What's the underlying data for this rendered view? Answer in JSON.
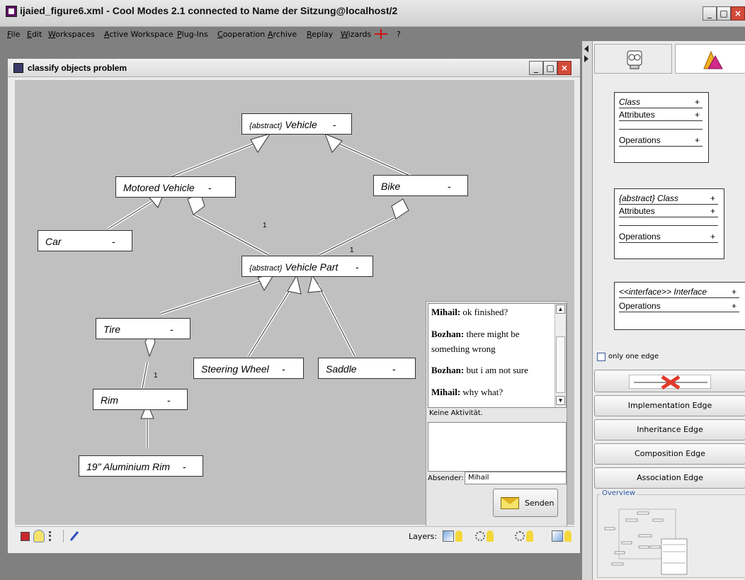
{
  "window": {
    "title": "ijaied_figure6.xml - Cool Modes 2.1 connected to Name der Sitzung@localhost/2"
  },
  "menu": {
    "items": [
      "File",
      "Edit",
      "Workspaces",
      "Active Workspace",
      "Plug-Ins",
      "Cooperation",
      "Archive",
      "Replay",
      "Wizards",
      "?"
    ]
  },
  "inner_window": {
    "title": "classify objects problem"
  },
  "diagram": {
    "nodes": [
      {
        "label_tag": "{abstract}",
        "label": "Vehicle",
        "dash": "-"
      },
      {
        "label": "Motored Vehicle",
        "dash": "-"
      },
      {
        "label": "Bike",
        "dash": "-"
      },
      {
        "label": "Car",
        "dash": "-"
      },
      {
        "label_tag": "{abstract}",
        "label": "Vehicle Part",
        "dash": "-"
      },
      {
        "label": "Tire",
        "dash": "-"
      },
      {
        "label": "Steering Wheel",
        "dash": "-"
      },
      {
        "label": "Saddle",
        "dash": "-"
      },
      {
        "label": "Rim",
        "dash": "-"
      },
      {
        "label": "19\" Aluminium Rim",
        "dash": "-"
      }
    ],
    "multiplicities": [
      "1",
      "1",
      "1"
    ]
  },
  "chat": {
    "messages": [
      {
        "sender": "Mihail:",
        "text": "ok finished?"
      },
      {
        "sender": "Bozhan:",
        "text": "there might be something wrong"
      },
      {
        "sender": "Bozhan:",
        "text": "but i am not sure"
      },
      {
        "sender": "Mihail:",
        "text": "why what?"
      }
    ],
    "status": "Keine Aktivität.",
    "sender_label": "Absender:",
    "sender_value": "Mihail",
    "send_label": "Senden"
  },
  "bottom": {
    "layers_label": "Layers:"
  },
  "palette": {
    "class_box": {
      "name": "Class",
      "attributes": "Attributes",
      "operations": "Operations",
      "plus": "+"
    },
    "abstract_box": {
      "name": "{abstract} Class",
      "attributes": "Attributes",
      "operations": "Operations",
      "plus": "+"
    },
    "interface_box": {
      "name": "<<interface>> Interface",
      "operations": "Operations",
      "plus": "+"
    },
    "only_one_edge": "only one edge",
    "edges": [
      "Implementation Edge",
      "Inheritance Edge",
      "Composition Edge",
      "Association Edge"
    ],
    "overview_label": "Overview"
  },
  "colors": {
    "canvas": "#c0c0c0",
    "close": "#d24a3a"
  }
}
